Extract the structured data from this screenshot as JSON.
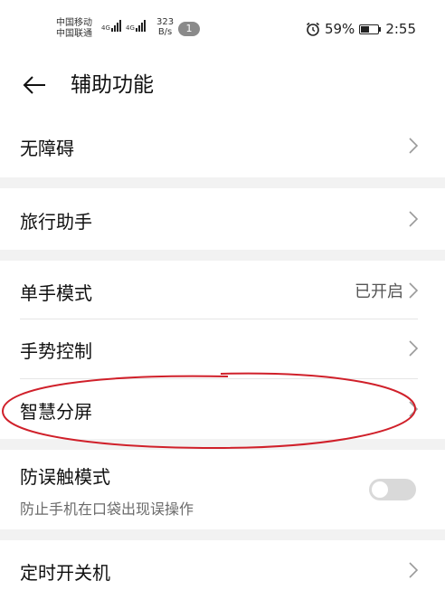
{
  "status_bar": {
    "carrier_1": "中国移动",
    "carrier_2": "中国联通",
    "net_type_1": "4G",
    "net_type_2": "4G",
    "speed_value": "323",
    "speed_unit": "B/s",
    "notification_count": "1",
    "alarm_icon": "alarm-clock-icon",
    "battery_percent": "59%",
    "battery_level": 0.59,
    "time": "2:55"
  },
  "header": {
    "back_icon": "back-arrow-icon",
    "title": "辅助功能"
  },
  "settings": {
    "accessibility": {
      "label": "无障碍"
    },
    "travel_assistant": {
      "label": "旅行助手"
    },
    "one_hand_mode": {
      "label": "单手模式",
      "value": "已开启"
    },
    "gesture_control": {
      "label": "手势控制"
    },
    "smart_split_screen": {
      "label": "智慧分屏"
    },
    "accidental_touch": {
      "label": "防误触模式",
      "description": "防止手机在口袋出现误操作",
      "enabled": false
    },
    "scheduled_power": {
      "label": "定时开关机"
    }
  },
  "annotation_color": "#d0202a"
}
